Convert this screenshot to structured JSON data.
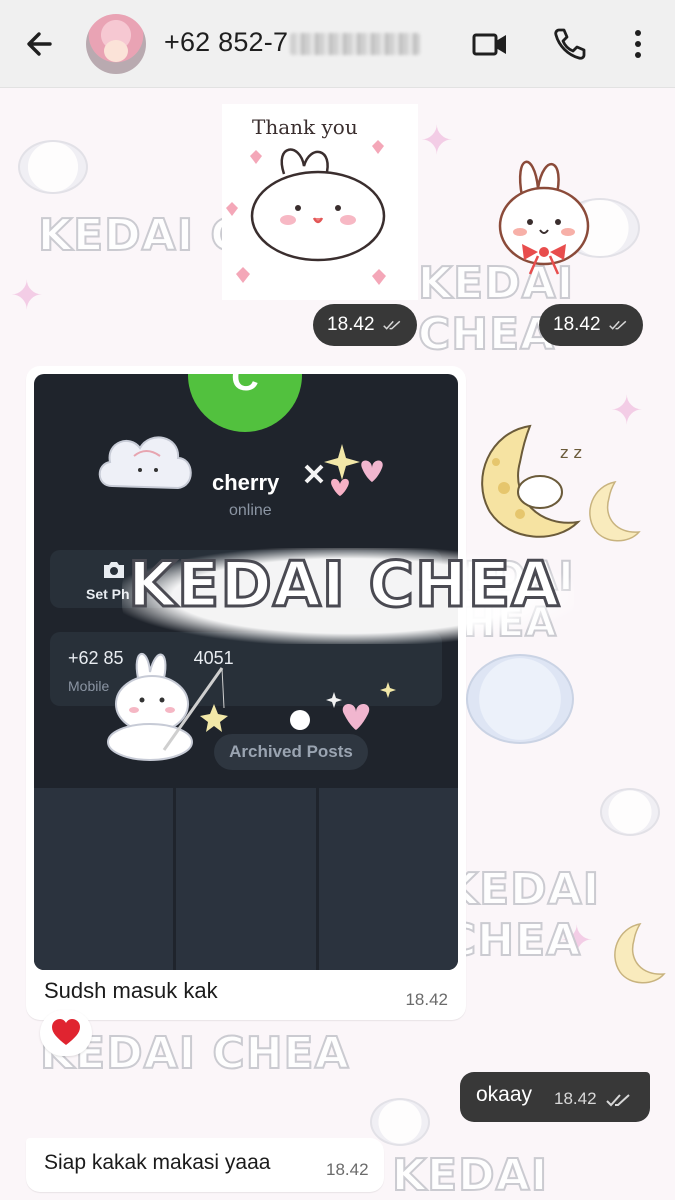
{
  "header": {
    "contact_phone": "+62 852-7",
    "icons": [
      "back-arrow-icon",
      "video-call-icon",
      "phone-call-icon",
      "more-vert-icon"
    ]
  },
  "wallpaper": {
    "watermark_text": "KEDAI CHEA"
  },
  "stickers": [
    {
      "name": "thank-you-bunny-sticker",
      "text": "Thank you",
      "time": "18.42"
    },
    {
      "name": "bunny-heart-sticker",
      "time": "18.42"
    }
  ],
  "media_message": {
    "caption": "Sudsh masuk kak",
    "time": "18.42",
    "screenshot": {
      "avatar_letter": "C",
      "name": "cherry",
      "status": "online",
      "set_photo_label": "Set Ph",
      "phone_number": "+62 85",
      "phone_number_tail": "4051",
      "phone_sub": "Mobile",
      "archived_label": "Archived Posts"
    },
    "watermark": "KEDAI CHEA"
  },
  "reaction": {
    "emoji": "❤️"
  },
  "outgoing_message": {
    "text": "okaay",
    "time": "18.42"
  },
  "incoming_message": {
    "text": "Siap kakak makasi yaaa",
    "time": "18.42"
  },
  "colors": {
    "header_bg": "#f0f0f0",
    "outgoing_bg": "#383838",
    "incoming_bg": "#ffffff",
    "avatar_green": "#52c13e"
  }
}
